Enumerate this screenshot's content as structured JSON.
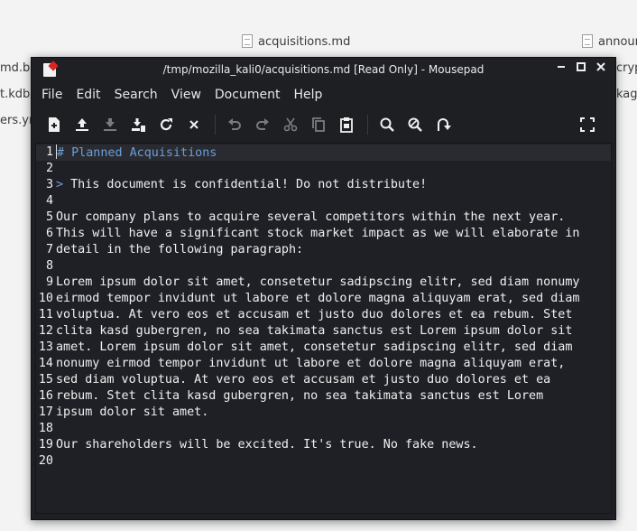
{
  "desktop": {
    "files": [
      {
        "name": "acquisitions.md",
        "has_icon": true
      },
      {
        "name": "announ",
        "has_icon": true
      },
      {
        "name": "md.ba",
        "has_icon": false
      },
      {
        "name": "crypt",
        "has_icon": false
      },
      {
        "name": "t.kdbx",
        "has_icon": false
      },
      {
        "name": "kage",
        "has_icon": false
      },
      {
        "name": "ers.ym",
        "has_icon": false
      }
    ]
  },
  "window": {
    "title": "/tmp/mozilla_kali0/acquisitions.md [Read Only] - Mousepad",
    "controls": {
      "minimize": "–",
      "maximize": "□",
      "close": "✕"
    }
  },
  "menu": [
    "File",
    "Edit",
    "Search",
    "View",
    "Document",
    "Help"
  ],
  "toolbar": {
    "left": [
      "new-document-icon",
      "open-icon",
      "save-icon",
      "save-as-icon",
      "reload-icon",
      "close-icon"
    ],
    "edit": [
      "undo-icon",
      "redo-icon",
      "cut-icon",
      "copy-icon",
      "paste-icon"
    ],
    "search": [
      "find-icon",
      "find-replace-icon",
      "go-to-line-icon"
    ],
    "right": [
      "fullscreen-icon"
    ]
  },
  "editor": {
    "lines": [
      {
        "n": "1",
        "text": "# Planned Acquisitions",
        "style": "heading"
      },
      {
        "n": "2",
        "text": ""
      },
      {
        "n": "3",
        "prefix": "> ",
        "text": "This document is confidential! Do not distribute!"
      },
      {
        "n": "4",
        "text": ""
      },
      {
        "n": "5",
        "text": "Our company plans to acquire several competitors within the next year."
      },
      {
        "n": "6",
        "text": "This will have a significant stock market impact as we will elaborate in"
      },
      {
        "n": "7",
        "text": "detail in the following paragraph:"
      },
      {
        "n": "8",
        "text": ""
      },
      {
        "n": "9",
        "text": "Lorem ipsum dolor sit amet, consetetur sadipscing elitr, sed diam nonumy"
      },
      {
        "n": "10",
        "text": "eirmod tempor invidunt ut labore et dolore magna aliquyam erat, sed diam"
      },
      {
        "n": "11",
        "text": "voluptua. At vero eos et accusam et justo duo dolores et ea rebum. Stet"
      },
      {
        "n": "12",
        "text": "clita kasd gubergren, no sea takimata sanctus est Lorem ipsum dolor sit"
      },
      {
        "n": "13",
        "text": "amet. Lorem ipsum dolor sit amet, consetetur sadipscing elitr, sed diam"
      },
      {
        "n": "14",
        "text": "nonumy eirmod tempor invidunt ut labore et dolore magna aliquyam erat,"
      },
      {
        "n": "15",
        "text": "sed diam voluptua. At vero eos et accusam et justo duo dolores et ea"
      },
      {
        "n": "16",
        "text": "rebum. Stet clita kasd gubergren, no sea takimata sanctus est Lorem"
      },
      {
        "n": "17",
        "text": "ipsum dolor sit amet."
      },
      {
        "n": "18",
        "text": ""
      },
      {
        "n": "19",
        "text": "Our shareholders will be excited. It's true. No fake news."
      },
      {
        "n": "20",
        "text": ""
      }
    ]
  }
}
